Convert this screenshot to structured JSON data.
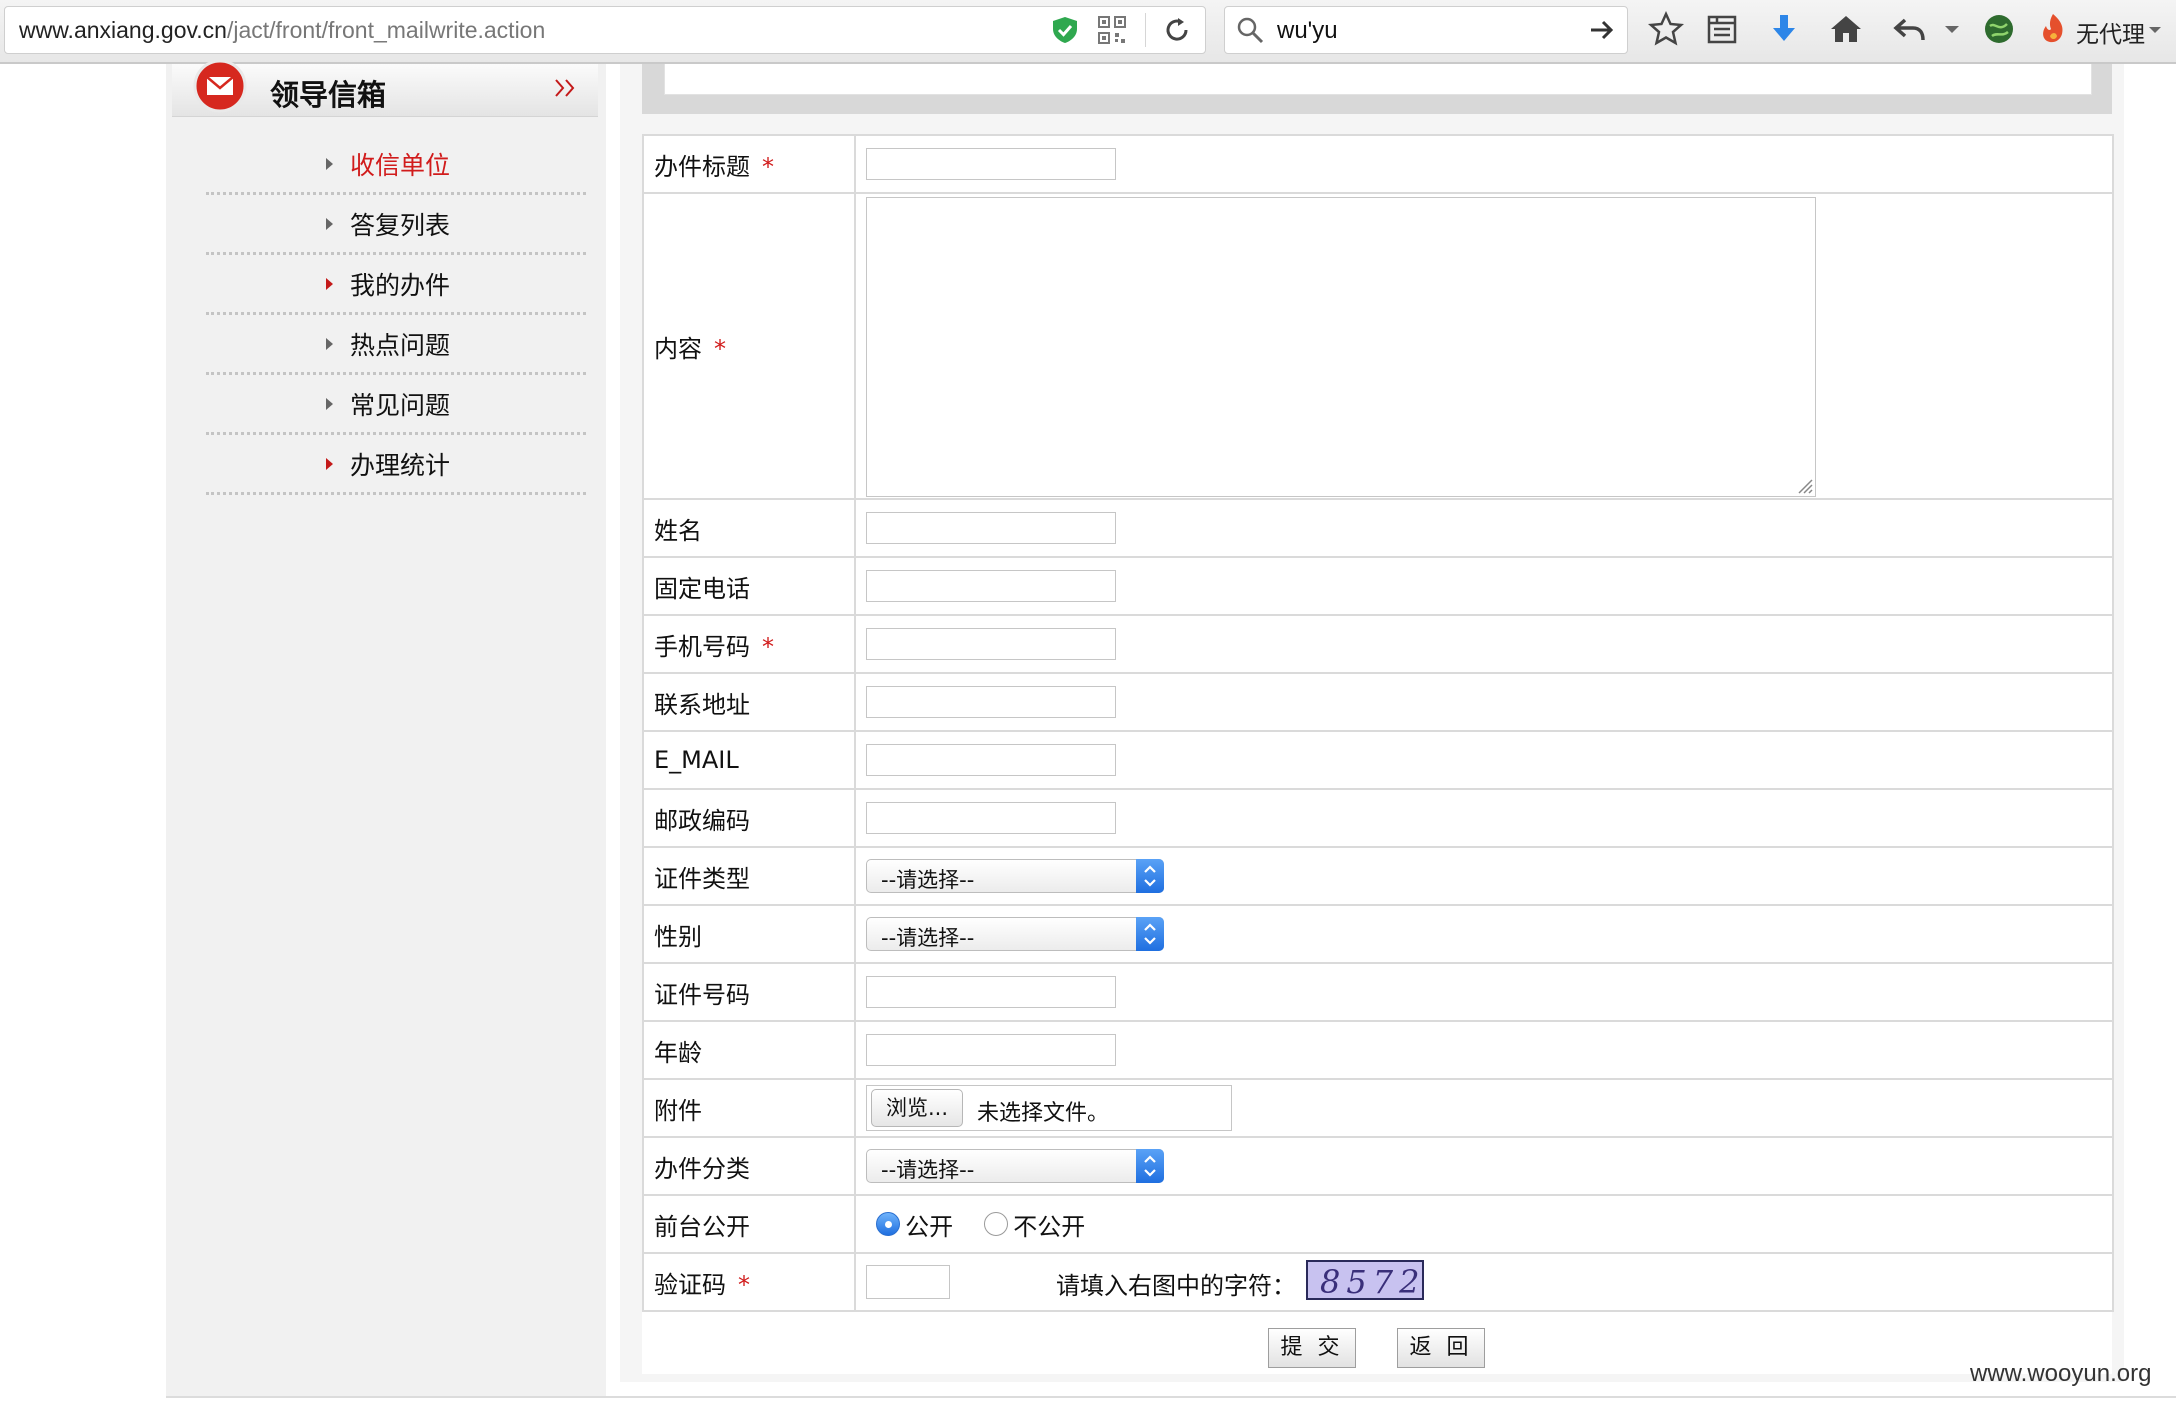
{
  "browser": {
    "url_host": "www.anxiang.gov.cn",
    "url_path": "/jact/front/front_mailwrite.action",
    "search_query": "wu'yu",
    "proxy_label": "无代理"
  },
  "sidebar": {
    "title": "领导信箱",
    "items": [
      {
        "label": "收信单位",
        "active": true
      },
      {
        "label": "答复列表",
        "active": false
      },
      {
        "label": "我的办件",
        "active": false
      },
      {
        "label": "热点问题",
        "active": false
      },
      {
        "label": "常见问题",
        "active": false
      },
      {
        "label": "办理统计",
        "active": false
      }
    ]
  },
  "form": {
    "required_mark": "*",
    "title_label": "办件标题",
    "content_label": "内容",
    "name_label": "姓名",
    "phone_label": "固定电话",
    "mobile_label": "手机号码",
    "address_label": "联系地址",
    "email_label": "E_MAIL",
    "postcode_label": "邮政编码",
    "id_type_label": "证件类型",
    "id_type_value": "--请选择--",
    "gender_label": "性别",
    "gender_value": "--请选择--",
    "id_number_label": "证件号码",
    "age_label": "年龄",
    "attachment_label": "附件",
    "browse_label": "浏览...",
    "file_status": "未选择文件。",
    "category_label": "办件分类",
    "category_value": "--请选择--",
    "public_label": "前台公开",
    "public_yes": "公开",
    "public_no": "不公开",
    "captcha_label": "验证码",
    "captcha_prompt": "请填入右图中的字符：",
    "captcha_text": "8572"
  },
  "buttons": {
    "submit": "提 交",
    "back": "返 回"
  },
  "watermark": "www.wooyun.org"
}
